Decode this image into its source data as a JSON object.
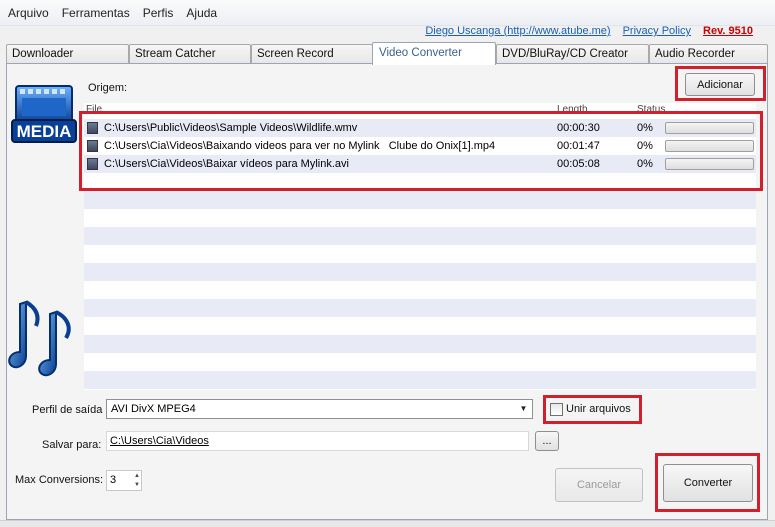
{
  "menu": [
    "Arquivo",
    "Ferramentas",
    "Perfis",
    "Ajuda"
  ],
  "links": {
    "author": "Diego Uscanga (http://www.atube.me)",
    "privacy": "Privacy Policy",
    "rev": "Rev. 9510"
  },
  "tabs": [
    {
      "label": "Downloader",
      "active": false
    },
    {
      "label": "Stream Catcher",
      "active": false
    },
    {
      "label": "Screen Record",
      "active": false
    },
    {
      "label": "Video Converter",
      "active": true
    },
    {
      "label": "DVD/BluRay/CD Creator",
      "active": false
    },
    {
      "label": "Audio Recorder",
      "active": false
    }
  ],
  "converter": {
    "origin_label": "Origem:",
    "add_button": "Adicionar",
    "media_logo_text": "MEDIA",
    "columns": {
      "file": "File",
      "length": "Length",
      "status": "Status"
    },
    "files": [
      {
        "path": "C:\\Users\\Public\\Videos\\Sample Videos\\Wildlife.wmv",
        "length": "00:00:30",
        "status": "0%",
        "progress": 0
      },
      {
        "path": "C:\\Users\\Cia\\Videos\\Baixando videos para ver no Mylink   Clube do Onix[1].mp4",
        "length": "00:01:47",
        "status": "0%",
        "progress": 0
      },
      {
        "path": "C:\\Users\\Cia\\Videos\\Baixar vídeos para Mylink.avi",
        "length": "00:05:08",
        "status": "0%",
        "progress": 0
      }
    ],
    "profile_label": "Perfil de saída",
    "profile_value": "AVI DivX MPEG4",
    "merge_label": "Unir arquivos",
    "merge_checked": false,
    "save_label": "Salvar para:",
    "save_path": "C:\\Users\\Cia\\Videos",
    "browse_button": "...",
    "max_label": "Max Conversions:",
    "max_value": "3",
    "cancel_button": "Cancelar",
    "convert_button": "Converter"
  }
}
